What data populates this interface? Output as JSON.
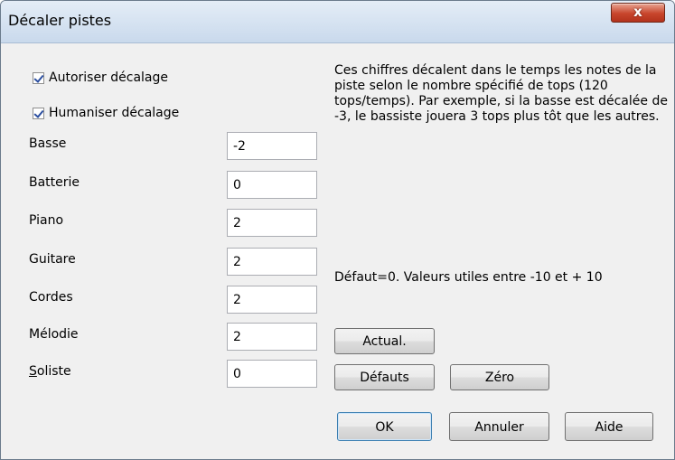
{
  "window": {
    "title": "Décaler pistes",
    "close_label": "x"
  },
  "checkboxes": [
    {
      "label": "Autoriser décalage",
      "checked": true
    },
    {
      "label": "Humaniser décalage",
      "checked": true
    }
  ],
  "fields": [
    {
      "label": "Basse",
      "value": "-2"
    },
    {
      "label": "Batterie",
      "value": "0"
    },
    {
      "label": "Piano",
      "value": "2"
    },
    {
      "label": "Guitare",
      "value": "2"
    },
    {
      "label": "Cordes",
      "value": "2"
    },
    {
      "label": "Mélodie",
      "value": "2"
    },
    {
      "label_first": "S",
      "label_rest": "oliste",
      "value": "0"
    }
  ],
  "description": "Ces chiffres décalent dans le temps les notes de la piste selon le nombre spécifié de tops (120 tops/temps). Par exemple, si la basse est décalée de -3, le bassiste jouera 3 tops plus tôt que les autres.",
  "defaults_info": "Défaut=0. Valeurs utiles entre -10 et + 10",
  "buttons": {
    "update": "Actual.",
    "defaults": "Défauts",
    "zero": "Zéro",
    "ok": "OK",
    "cancel": "Annuler",
    "help": "Aide"
  }
}
